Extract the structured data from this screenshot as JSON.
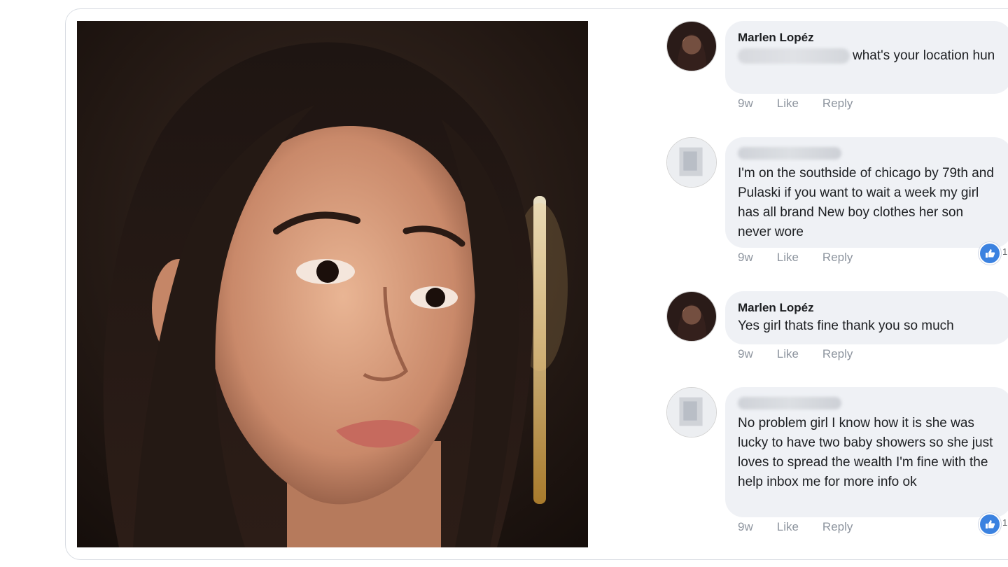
{
  "comments": [
    {
      "author": "Marlen Lopéz",
      "text": "what's your location hun",
      "time": "9w",
      "like": "Like",
      "reply": "Reply"
    },
    {
      "author": "",
      "text": "I'm on the southside of chicago by 79th and Pulaski if you want to wait a week my girl has all brand New boy clothes her son never wore",
      "time": "9w",
      "like": "Like",
      "reply": "Reply",
      "reactions": "1"
    },
    {
      "author": "Marlen Lopéz",
      "text": "Yes girl thats fine thank you so much",
      "time": "9w",
      "like": "Like",
      "reply": "Reply"
    },
    {
      "author": "",
      "text": "No problem girl I know how it is she was lucky to have two baby showers so she just loves to spread the wealth I'm fine with the help inbox me for more info ok",
      "time": "9w",
      "like": "Like",
      "reply": "Reply",
      "reactions": "1"
    }
  ],
  "colors": {
    "bubble": "#eff1f5",
    "meta": "#8d949e",
    "reaction": "#3b82e0"
  },
  "icons": [
    "like-reaction-icon",
    "avatar-photo"
  ]
}
